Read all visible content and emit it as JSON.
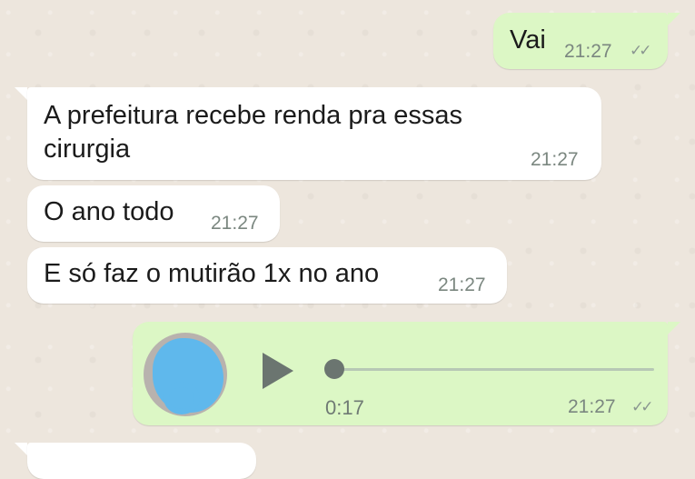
{
  "messages": [
    {
      "direction": "outgoing",
      "text": "Vai",
      "time": "21:27",
      "status_icon": "double-check-icon"
    },
    {
      "direction": "incoming",
      "text": "A prefeitura recebe renda pra essas\ncirurgia",
      "time": "21:27"
    },
    {
      "direction": "incoming",
      "text": "O ano todo",
      "time": "21:27"
    },
    {
      "direction": "incoming",
      "text": "E só faz o mutirão 1x no ano",
      "time": "21:27"
    }
  ],
  "voice_message": {
    "direction": "outgoing",
    "duration": "0:17",
    "time": "21:27",
    "progress": 0,
    "status_icon": "double-check-icon",
    "play_icon": "play-icon"
  },
  "colors": {
    "incoming_bubble": "#ffffff",
    "outgoing_bubble": "#dcf7c5",
    "background": "#ede6dd"
  }
}
